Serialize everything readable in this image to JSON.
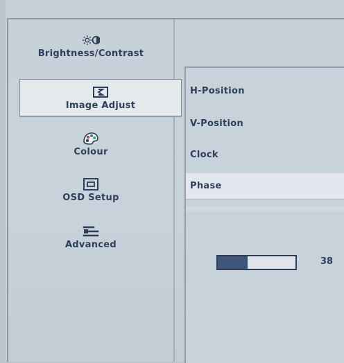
{
  "sidebar": {
    "items": [
      {
        "label": "Brightness/Contrast",
        "icon": "brightness-contrast-icon"
      },
      {
        "label": "Image Adjust",
        "icon": "image-adjust-icon"
      },
      {
        "label": "Colour",
        "icon": "colour-palette-icon"
      },
      {
        "label": "OSD Setup",
        "icon": "osd-setup-icon"
      },
      {
        "label": "Advanced",
        "icon": "advanced-settings-icon"
      }
    ],
    "selected_index": 1
  },
  "submenu": {
    "items": [
      {
        "label": "H-Position"
      },
      {
        "label": "V-Position"
      },
      {
        "label": "Clock"
      },
      {
        "label": "Phase"
      }
    ],
    "selected_index": 3
  },
  "slider": {
    "value": "38",
    "fill_fraction": 0.38
  },
  "colors": {
    "background": "#c6d0d8",
    "highlight": "#e4e9ee",
    "text": "#2f3f58",
    "slider_fill": "#3e5677"
  }
}
